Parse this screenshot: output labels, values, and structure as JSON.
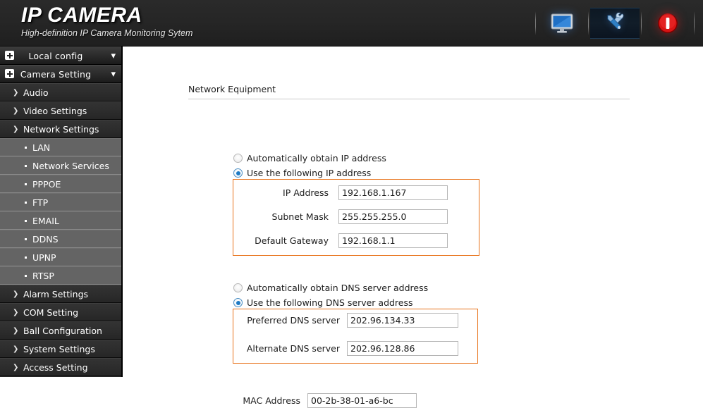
{
  "header": {
    "title": "IP CAMERA",
    "subtitle": "High-definition IP Camera Monitoring Sytem",
    "toolbar": [
      {
        "name": "live-view-icon",
        "label": "Live View",
        "selected": false
      },
      {
        "name": "settings-icon",
        "label": "Settings",
        "selected": true
      },
      {
        "name": "power-icon",
        "label": "Logout",
        "selected": false
      }
    ]
  },
  "sidebar": {
    "groups": [
      {
        "label": "Local config",
        "type": "group"
      },
      {
        "label": "Camera Setting",
        "type": "group"
      }
    ],
    "items": [
      {
        "label": "Audio",
        "type": "item"
      },
      {
        "label": "Video Settings",
        "type": "item"
      },
      {
        "label": "Network Settings",
        "type": "item"
      },
      {
        "label": "LAN",
        "type": "sub"
      },
      {
        "label": "Network Services",
        "type": "sub"
      },
      {
        "label": "PPPOE",
        "type": "sub"
      },
      {
        "label": "FTP",
        "type": "sub"
      },
      {
        "label": "EMAIL",
        "type": "sub"
      },
      {
        "label": "DDNS",
        "type": "sub"
      },
      {
        "label": "UPNP",
        "type": "sub"
      },
      {
        "label": "RTSP",
        "type": "sub"
      },
      {
        "label": "Alarm Settings",
        "type": "item"
      },
      {
        "label": "COM Setting",
        "type": "item"
      },
      {
        "label": "Ball Configuration",
        "type": "item"
      },
      {
        "label": "System Settings",
        "type": "item"
      },
      {
        "label": "Access Setting",
        "type": "item"
      }
    ]
  },
  "main": {
    "section_title": "Network Equipment",
    "ip_mode": {
      "auto_label": "Automatically obtain IP address",
      "manual_label": "Use the following IP address",
      "selected": "manual"
    },
    "ip_fields": [
      {
        "label": "IP Address",
        "value": "192.168.1.167"
      },
      {
        "label": "Subnet Mask",
        "value": "255.255.255.0"
      },
      {
        "label": "Default Gateway",
        "value": "192.168.1.1"
      }
    ],
    "dns_mode": {
      "auto_label": "Automatically obtain DNS server address",
      "manual_label": "Use the following DNS server address",
      "selected": "manual"
    },
    "dns_fields": [
      {
        "label": "Preferred DNS server",
        "value": "202.96.134.33"
      },
      {
        "label": "Alternate DNS server",
        "value": "202.96.128.86"
      }
    ],
    "mac": {
      "label": "MAC Address",
      "value": "00-2b-38-01-a6-bc"
    }
  },
  "colors": {
    "accent_orange": "#e8721a",
    "header_bg": "#262626",
    "sidebar_bg": "#2b2b2b",
    "sub_item_bg": "#646464",
    "radio_blue": "#1e7ac4"
  }
}
